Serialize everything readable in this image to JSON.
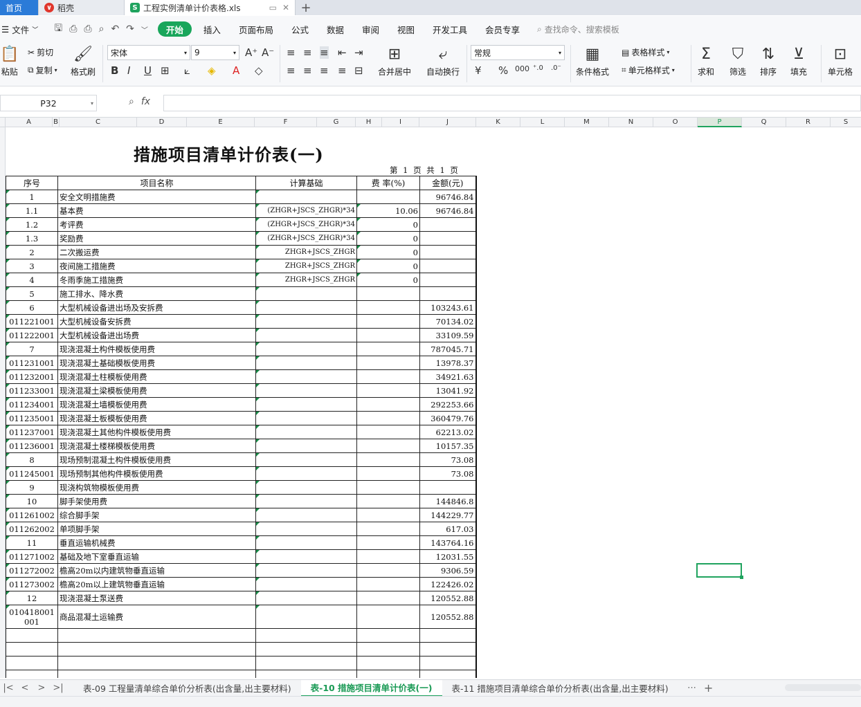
{
  "tabs": {
    "home": "首页",
    "daoke": "稻壳",
    "file": "工程实例清单计价表格.xls"
  },
  "menu": {
    "file": "文件",
    "items": [
      "开始",
      "插入",
      "页面布局",
      "公式",
      "数据",
      "审阅",
      "视图",
      "开发工具",
      "会员专享"
    ],
    "search": "查找命令、搜索模板"
  },
  "ribbon": {
    "paste": "粘贴",
    "cut": "剪切",
    "copy": "复制",
    "format_painter": "格式刷",
    "font_name": "宋体",
    "font_size": "9",
    "merge_center": "合并居中",
    "wrap": "自动换行",
    "number_format": "常规",
    "cond_format": "条件格式",
    "table_style": "表格样式",
    "cell_style": "单元格样式",
    "sum": "求和",
    "filter": "筛选",
    "sort": "排序",
    "fill": "填充",
    "cell": "单元格"
  },
  "formula_bar": {
    "cell_ref": "P32",
    "fx": "fx",
    "value": ""
  },
  "columns": [
    "A",
    "B",
    "C",
    "D",
    "E",
    "F",
    "G",
    "H",
    "I",
    "J",
    "K",
    "L",
    "M",
    "N",
    "O",
    "P",
    "Q",
    "R",
    "S"
  ],
  "selected_column": "P",
  "sheet": {
    "title": "措施项目清单计价表(一)",
    "page_info": "第 1 页 共 1 页",
    "headers": [
      "序号",
      "项目名称",
      "计算基础",
      "费 率(%)",
      "金额(元)"
    ],
    "rows": [
      {
        "no": "1",
        "name": "安全文明措施费",
        "base": "",
        "rate": "",
        "amount": "96746.84"
      },
      {
        "no": "1.1",
        "name": "基本费",
        "base": "(ZHGR+JSCS_ZHGR)*34",
        "rate": "10.06",
        "amount": "96746.84"
      },
      {
        "no": "1.2",
        "name": "考评费",
        "base": "(ZHGR+JSCS_ZHGR)*34",
        "rate": "0",
        "amount": ""
      },
      {
        "no": "1.3",
        "name": "奖励费",
        "base": "(ZHGR+JSCS_ZHGR)*34",
        "rate": "0",
        "amount": ""
      },
      {
        "no": "2",
        "name": "二次搬运费",
        "base": "ZHGR+JSCS_ZHGR",
        "rate": "0",
        "amount": ""
      },
      {
        "no": "3",
        "name": "夜间施工措施费",
        "base": "ZHGR+JSCS_ZHGR",
        "rate": "0",
        "amount": ""
      },
      {
        "no": "4",
        "name": "冬雨季施工措施费",
        "base": "ZHGR+JSCS_ZHGR",
        "rate": "0",
        "amount": ""
      },
      {
        "no": "5",
        "name": "施工排水、降水费",
        "base": "",
        "rate": "",
        "amount": ""
      },
      {
        "no": "6",
        "name": "大型机械设备进出场及安拆费",
        "base": "",
        "rate": "",
        "amount": "103243.61"
      },
      {
        "no": "011221001",
        "name": "大型机械设备安拆费",
        "base": "",
        "rate": "",
        "amount": "70134.02"
      },
      {
        "no": "011222001",
        "name": "大型机械设备进出场费",
        "base": "",
        "rate": "",
        "amount": "33109.59"
      },
      {
        "no": "7",
        "name": "现浇混凝土构件模板使用费",
        "base": "",
        "rate": "",
        "amount": "787045.71"
      },
      {
        "no": "011231001",
        "name": "现浇混凝土基础模板使用费",
        "base": "",
        "rate": "",
        "amount": "13978.37"
      },
      {
        "no": "011232001",
        "name": "现浇混凝土柱模板使用费",
        "base": "",
        "rate": "",
        "amount": "34921.63"
      },
      {
        "no": "011233001",
        "name": "现浇混凝土梁模板使用费",
        "base": "",
        "rate": "",
        "amount": "13041.92"
      },
      {
        "no": "011234001",
        "name": "现浇混凝土墙模板使用费",
        "base": "",
        "rate": "",
        "amount": "292253.66"
      },
      {
        "no": "011235001",
        "name": "现浇混凝土板模板使用费",
        "base": "",
        "rate": "",
        "amount": "360479.76"
      },
      {
        "no": "011237001",
        "name": "现浇混凝土其他构件模板使用费",
        "base": "",
        "rate": "",
        "amount": "62213.02"
      },
      {
        "no": "011236001",
        "name": "现浇混凝土楼梯模板使用费",
        "base": "",
        "rate": "",
        "amount": "10157.35"
      },
      {
        "no": "8",
        "name": "现场预制混凝土构件模板使用费",
        "base": "",
        "rate": "",
        "amount": "73.08"
      },
      {
        "no": "011245001",
        "name": "现场预制其他构件模板使用费",
        "base": "",
        "rate": "",
        "amount": "73.08"
      },
      {
        "no": "9",
        "name": "现浇构筑物模板使用费",
        "base": "",
        "rate": "",
        "amount": ""
      },
      {
        "no": "10",
        "name": "脚手架使用费",
        "base": "",
        "rate": "",
        "amount": "144846.8"
      },
      {
        "no": "011261002",
        "name": "综合脚手架",
        "base": "",
        "rate": "",
        "amount": "144229.77"
      },
      {
        "no": "011262002",
        "name": "单项脚手架",
        "base": "",
        "rate": "",
        "amount": "617.03"
      },
      {
        "no": "11",
        "name": "垂直运输机械费",
        "base": "",
        "rate": "",
        "amount": "143764.16"
      },
      {
        "no": "011271002",
        "name": "基础及地下室垂直运输",
        "base": "",
        "rate": "",
        "amount": "12031.55"
      },
      {
        "no": "011272002",
        "name": "檐高20m以内建筑物垂直运输",
        "base": "",
        "rate": "",
        "amount": "9306.59"
      },
      {
        "no": "011273002",
        "name": "檐高20m以上建筑物垂直运输",
        "base": "",
        "rate": "",
        "amount": "122426.02"
      },
      {
        "no": "12",
        "name": "现浇混凝土泵送费",
        "base": "",
        "rate": "",
        "amount": "120552.88"
      },
      {
        "no": "010418001001",
        "name": "商品混凝土运输费",
        "base": "",
        "rate": "",
        "amount": "120552.88"
      }
    ],
    "blank_rows": 4
  },
  "sheet_tabs": [
    "表-09 工程量清单综合单价分析表(出含量,出主要材料)",
    "表-10 措施项目清单计价表(一)",
    "表-11 措施项目清单综合单价分析表(出含量,出主要材料)"
  ],
  "active_sheet_tab": 1,
  "colors": {
    "accent": "#1fa35e",
    "home_tab": "#2b7bd8"
  }
}
